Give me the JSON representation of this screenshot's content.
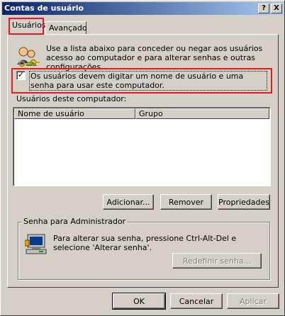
{
  "window": {
    "title": "Contas de usuário",
    "help_glyph": "?",
    "close_glyph": "X"
  },
  "tabs": [
    {
      "label": "Usuários",
      "active": true
    },
    {
      "label": "Avançado",
      "active": false
    }
  ],
  "intro": {
    "icon": "users-keys-icon",
    "text": "Use a lista abaixo para conceder ou negar aos usuários acesso ao computador e para alterar senhas e outras configurações."
  },
  "require_login": {
    "checked": true,
    "check_glyph": "✓",
    "label": "Os usuários devem digitar um nome de usuário e uma senha para usar este computador."
  },
  "users_list": {
    "label": "Usuários deste computador:",
    "columns": [
      "Nome de usuário",
      "Grupo"
    ],
    "rows": []
  },
  "list_buttons": {
    "add": "Adicionar...",
    "remove": "Remover",
    "properties": "Propriedades"
  },
  "admin_password": {
    "group_label": "Senha para Administrador",
    "icon": "computer-icon",
    "text": "Para alterar sua senha, pressione Ctrl-Alt-Del e selecione 'Alterar senha'.",
    "reset_button": "Redefinir senha..."
  },
  "dialog_buttons": {
    "ok": "OK",
    "cancel": "Cancelar",
    "apply": "Aplicar"
  },
  "highlight_color": "#e51b24"
}
